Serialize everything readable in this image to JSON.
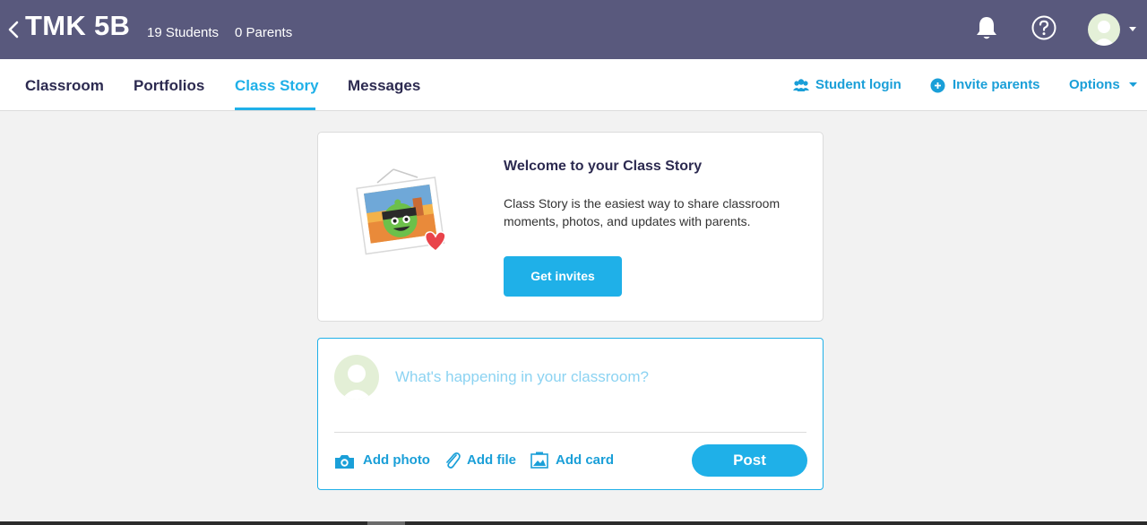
{
  "header": {
    "class_name": "TMK 5B",
    "students": "19 Students",
    "parents": "0 Parents",
    "icons": [
      "back-chevron-icon",
      "bell-icon",
      "help-icon",
      "avatar"
    ]
  },
  "nav": {
    "tabs": [
      {
        "label": "Classroom",
        "active": false
      },
      {
        "label": "Portfolios",
        "active": false
      },
      {
        "label": "Class Story",
        "active": true
      },
      {
        "label": "Messages",
        "active": false
      }
    ],
    "student_login": "Student login",
    "invite_parents": "Invite parents",
    "options": "Options"
  },
  "welcome": {
    "title": "Welcome to your Class Story",
    "body": "Class Story is the easiest way to share classroom moments, photos, and updates with parents.",
    "button": "Get invites"
  },
  "compose": {
    "placeholder": "What's happening in your classroom?",
    "add_photo": "Add photo",
    "add_file": "Add file",
    "add_card": "Add card",
    "post": "Post"
  },
  "colors": {
    "header_bg": "#59597d",
    "accent": "#1fb0e8",
    "tab_text": "#2c2a50",
    "page_bg": "#f2f2f2"
  }
}
